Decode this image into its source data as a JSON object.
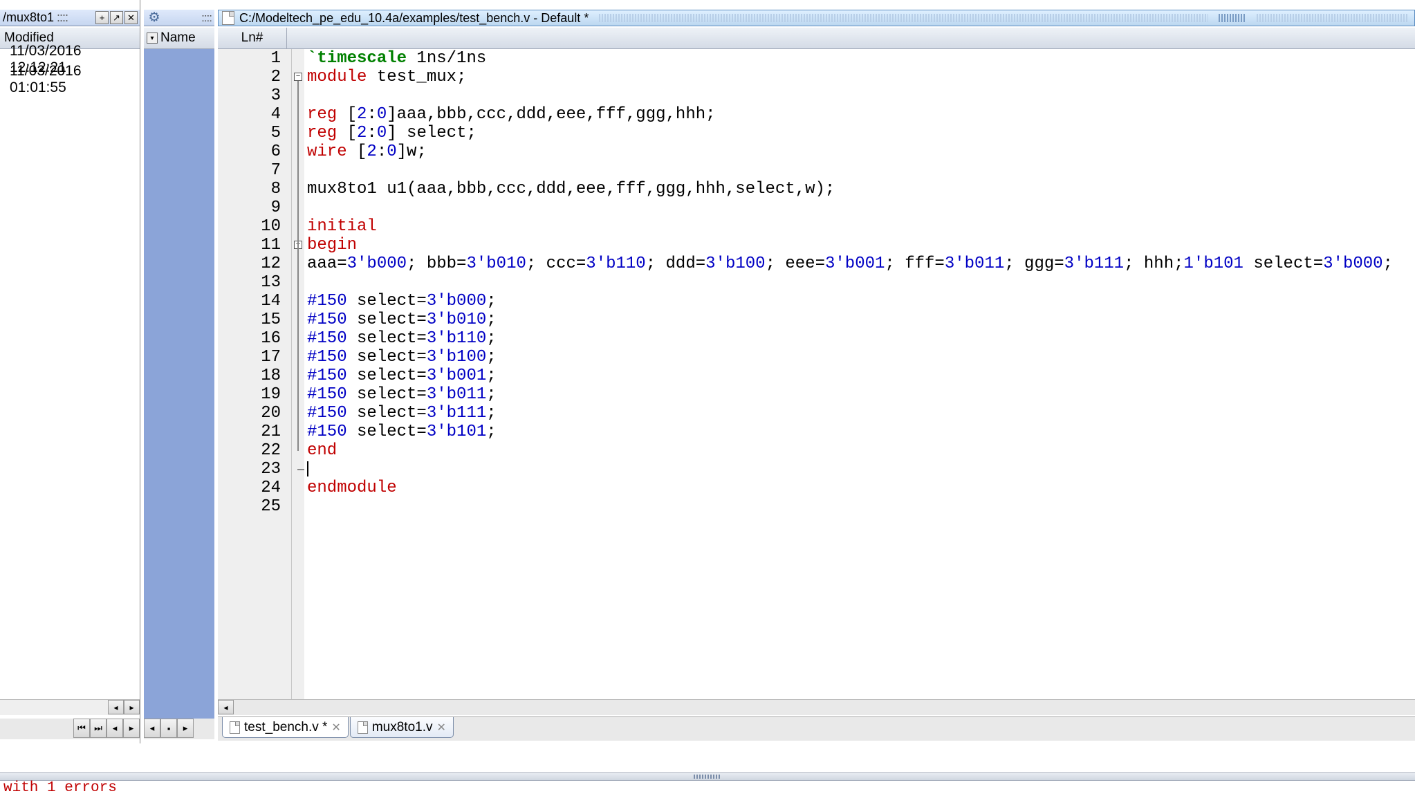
{
  "left": {
    "title": "/mux8to1",
    "header": "Modified",
    "rows": [
      "11/03/2016 12:12:21",
      "11/03/2016 01:01:55"
    ]
  },
  "mid": {
    "header": "Name"
  },
  "main": {
    "title": "C:/Modeltech_pe_edu_10.4a/examples/test_bench.v - Default *",
    "header_col": "Ln#",
    "tabs": [
      {
        "label": "test_bench.v *",
        "active": true
      },
      {
        "label": "mux8to1.v",
        "active": false
      }
    ]
  },
  "code": {
    "lines": [
      {
        "n": 1,
        "segs": [
          {
            "t": "`timescale",
            "c": "kw-green"
          },
          {
            "t": " 1ns/1ns",
            "c": ""
          }
        ]
      },
      {
        "n": 2,
        "fold": "box",
        "segs": [
          {
            "t": "module",
            "c": "kw-red"
          },
          {
            "t": " test_mux;",
            "c": ""
          }
        ]
      },
      {
        "n": 3,
        "segs": []
      },
      {
        "n": 4,
        "segs": [
          {
            "t": "reg",
            "c": "kw-red"
          },
          {
            "t": " [",
            "c": ""
          },
          {
            "t": "2",
            "c": "kw-blue"
          },
          {
            "t": ":",
            "c": ""
          },
          {
            "t": "0",
            "c": "kw-blue"
          },
          {
            "t": "]aaa,bbb,ccc,ddd,eee,fff,ggg,hhh;",
            "c": ""
          }
        ]
      },
      {
        "n": 5,
        "segs": [
          {
            "t": "reg",
            "c": "kw-red"
          },
          {
            "t": " [",
            "c": ""
          },
          {
            "t": "2",
            "c": "kw-blue"
          },
          {
            "t": ":",
            "c": ""
          },
          {
            "t": "0",
            "c": "kw-blue"
          },
          {
            "t": "] select;",
            "c": ""
          }
        ]
      },
      {
        "n": 6,
        "segs": [
          {
            "t": "wire",
            "c": "kw-red"
          },
          {
            "t": " [",
            "c": ""
          },
          {
            "t": "2",
            "c": "kw-blue"
          },
          {
            "t": ":",
            "c": ""
          },
          {
            "t": "0",
            "c": "kw-blue"
          },
          {
            "t": "]w;",
            "c": ""
          }
        ]
      },
      {
        "n": 7,
        "segs": []
      },
      {
        "n": 8,
        "segs": [
          {
            "t": "mux8to1 u1(aaa,bbb,ccc,ddd,eee,fff,ggg,hhh,select,w);",
            "c": ""
          }
        ]
      },
      {
        "n": 9,
        "segs": []
      },
      {
        "n": 10,
        "segs": [
          {
            "t": "initial",
            "c": "kw-red"
          }
        ]
      },
      {
        "n": 11,
        "fold": "box",
        "segs": [
          {
            "t": "begin",
            "c": "kw-red"
          }
        ]
      },
      {
        "n": 12,
        "segs": [
          {
            "t": "aaa=",
            "c": ""
          },
          {
            "t": "3'b000",
            "c": "kw-blue"
          },
          {
            "t": "; bbb=",
            "c": ""
          },
          {
            "t": "3'b010",
            "c": "kw-blue"
          },
          {
            "t": "; ccc=",
            "c": ""
          },
          {
            "t": "3'b110",
            "c": "kw-blue"
          },
          {
            "t": "; ddd=",
            "c": ""
          },
          {
            "t": "3'b100",
            "c": "kw-blue"
          },
          {
            "t": "; eee=",
            "c": ""
          },
          {
            "t": "3'b001",
            "c": "kw-blue"
          },
          {
            "t": "; fff=",
            "c": ""
          },
          {
            "t": "3'b011",
            "c": "kw-blue"
          },
          {
            "t": "; ggg=",
            "c": ""
          },
          {
            "t": "3'b111",
            "c": "kw-blue"
          },
          {
            "t": "; hhh;",
            "c": ""
          },
          {
            "t": "1'b101",
            "c": "kw-blue"
          },
          {
            "t": " select=",
            "c": ""
          },
          {
            "t": "3'b000",
            "c": "kw-blue"
          },
          {
            "t": ";",
            "c": ""
          }
        ]
      },
      {
        "n": 13,
        "segs": []
      },
      {
        "n": 14,
        "segs": [
          {
            "t": "#150",
            "c": "kw-blue"
          },
          {
            "t": " select=",
            "c": ""
          },
          {
            "t": "3'b000",
            "c": "kw-blue"
          },
          {
            "t": ";",
            "c": ""
          }
        ]
      },
      {
        "n": 15,
        "segs": [
          {
            "t": "#150",
            "c": "kw-blue"
          },
          {
            "t": " select=",
            "c": ""
          },
          {
            "t": "3'b010",
            "c": "kw-blue"
          },
          {
            "t": ";",
            "c": ""
          }
        ]
      },
      {
        "n": 16,
        "segs": [
          {
            "t": "#150",
            "c": "kw-blue"
          },
          {
            "t": " select=",
            "c": ""
          },
          {
            "t": "3'b110",
            "c": "kw-blue"
          },
          {
            "t": ";",
            "c": ""
          }
        ]
      },
      {
        "n": 17,
        "segs": [
          {
            "t": "#150",
            "c": "kw-blue"
          },
          {
            "t": " select=",
            "c": ""
          },
          {
            "t": "3'b100",
            "c": "kw-blue"
          },
          {
            "t": ";",
            "c": ""
          }
        ]
      },
      {
        "n": 18,
        "segs": [
          {
            "t": "#150",
            "c": "kw-blue"
          },
          {
            "t": " select=",
            "c": ""
          },
          {
            "t": "3'b001",
            "c": "kw-blue"
          },
          {
            "t": ";",
            "c": ""
          }
        ]
      },
      {
        "n": 19,
        "segs": [
          {
            "t": "#150",
            "c": "kw-blue"
          },
          {
            "t": " select=",
            "c": ""
          },
          {
            "t": "3'b011",
            "c": "kw-blue"
          },
          {
            "t": ";",
            "c": ""
          }
        ]
      },
      {
        "n": 20,
        "segs": [
          {
            "t": "#150",
            "c": "kw-blue"
          },
          {
            "t": " select=",
            "c": ""
          },
          {
            "t": "3'b111",
            "c": "kw-blue"
          },
          {
            "t": ";",
            "c": ""
          }
        ]
      },
      {
        "n": 21,
        "segs": [
          {
            "t": "#150",
            "c": "kw-blue"
          },
          {
            "t": " select=",
            "c": ""
          },
          {
            "t": "3'b101",
            "c": "kw-blue"
          },
          {
            "t": ";",
            "c": ""
          }
        ]
      },
      {
        "n": 22,
        "segs": [
          {
            "t": "end",
            "c": "kw-red"
          }
        ]
      },
      {
        "n": 23,
        "fold": "end",
        "cursor": true,
        "segs": []
      },
      {
        "n": 24,
        "segs": [
          {
            "t": "endmodule",
            "c": "kw-red"
          }
        ]
      },
      {
        "n": 25,
        "segs": []
      }
    ]
  },
  "console": "with 1 errors"
}
